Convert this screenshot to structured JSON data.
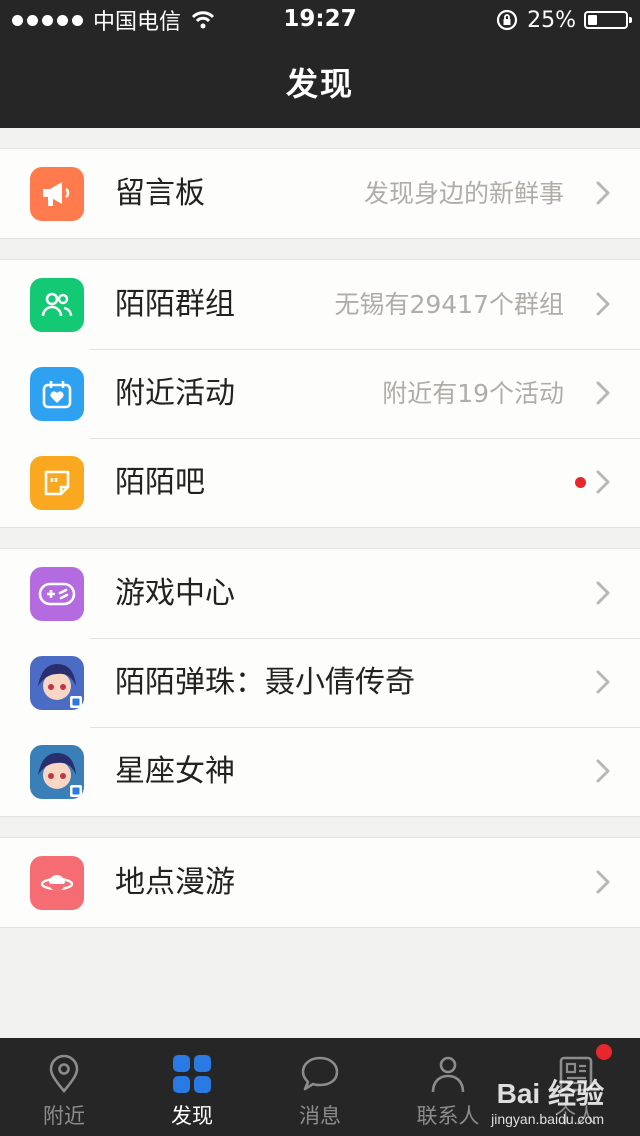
{
  "status_bar": {
    "carrier": "中国电信",
    "time": "19:27",
    "battery_percent": "25%",
    "battery_level": 0.25,
    "icons": [
      "signal-dots-icon",
      "wifi-icon",
      "orientation-lock-icon",
      "battery-icon"
    ]
  },
  "nav": {
    "title": "发现"
  },
  "groups": [
    [
      {
        "label": "留言板",
        "detail": "发现身边的新鲜事",
        "icon": "megaphone-icon",
        "color": "#ff7b4d"
      }
    ],
    [
      {
        "label": "陌陌群组",
        "detail": "无锡有29417个群组",
        "icon": "group-icon",
        "color": "#14c974"
      },
      {
        "label": "附近活动",
        "detail": "附近有19个活动",
        "icon": "calendar-heart-icon",
        "color": "#2ea1f0"
      },
      {
        "label": "陌陌吧",
        "detail": "",
        "icon": "quote-note-icon",
        "color": "#f9a81f",
        "new_dot": true
      }
    ],
    [
      {
        "label": "游戏中心",
        "detail": "",
        "icon": "gamepad-icon",
        "color": "#b56be0"
      },
      {
        "label": "陌陌弹珠：聂小倩传奇",
        "detail": "",
        "icon": "game-avatar-icon",
        "color": "#4a6cc4"
      },
      {
        "label": "星座女神",
        "detail": "",
        "icon": "game-avatar-icon",
        "color": "#3a7fb8"
      }
    ],
    [
      {
        "label": "地点漫游",
        "detail": "",
        "icon": "planet-icon",
        "color": "#f56d72"
      }
    ]
  ],
  "tabs": [
    {
      "label": "附近",
      "icon": "location-pin-icon",
      "active": false
    },
    {
      "label": "发现",
      "icon": "grid-icon",
      "active": true
    },
    {
      "label": "消息",
      "icon": "chat-bubble-icon",
      "active": false
    },
    {
      "label": "联系人",
      "icon": "person-icon",
      "active": false
    },
    {
      "label": "个人",
      "icon": "profile-card-icon",
      "active": false,
      "badge": true
    }
  ],
  "colors": {
    "bar": "#262626",
    "accent_blue": "#2a7ae4",
    "badge_red": "#e9262c"
  },
  "watermark": {
    "line1": "Bai 经验",
    "line2": "jingyan.baidu.com"
  }
}
